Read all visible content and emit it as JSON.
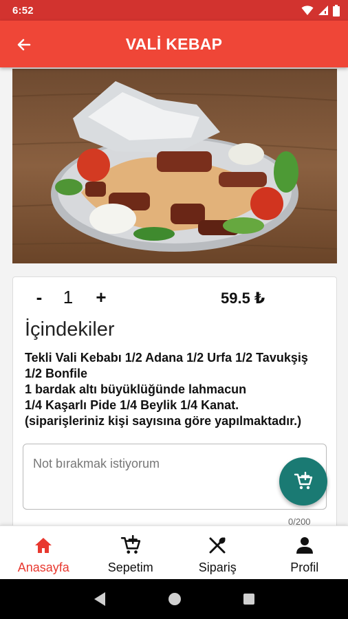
{
  "status_bar": {
    "time": "6:52"
  },
  "app_bar": {
    "title": "VALİ KEBAP"
  },
  "product": {
    "quantity": "1",
    "minus_label": "-",
    "plus_label": "+",
    "price": "59.5 ₺",
    "ingredients_title": "İçindekiler",
    "ingredients_lines": [
      "Tekli Vali Kebabı 1/2 Adana 1/2 Urfa 1/2 Tavukşiş",
      "1/2 Bonfile",
      "1 bardak altı büyüklüğünde lahmacun",
      "1/4 Kaşarlı Pide 1/4 Beylik 1/4 Kanat.",
      "(siparişleriniz kişi sayısına göre yapılmaktadır.)"
    ]
  },
  "note": {
    "placeholder": "Not bırakmak istiyorum",
    "counter": "0/200"
  },
  "bottom_nav": {
    "items": [
      {
        "label": "Anasayfa",
        "icon": "home-icon",
        "active": true
      },
      {
        "label": "Sepetim",
        "icon": "cart-add-icon",
        "active": false
      },
      {
        "label": "Sipariş",
        "icon": "fork-knife-icon",
        "active": false
      },
      {
        "label": "Profil",
        "icon": "person-icon",
        "active": false
      }
    ]
  },
  "colors": {
    "status_bar": "#d2332f",
    "app_bar": "#ef4637",
    "fab": "#1a7a73",
    "active_nav": "#e8382f"
  }
}
